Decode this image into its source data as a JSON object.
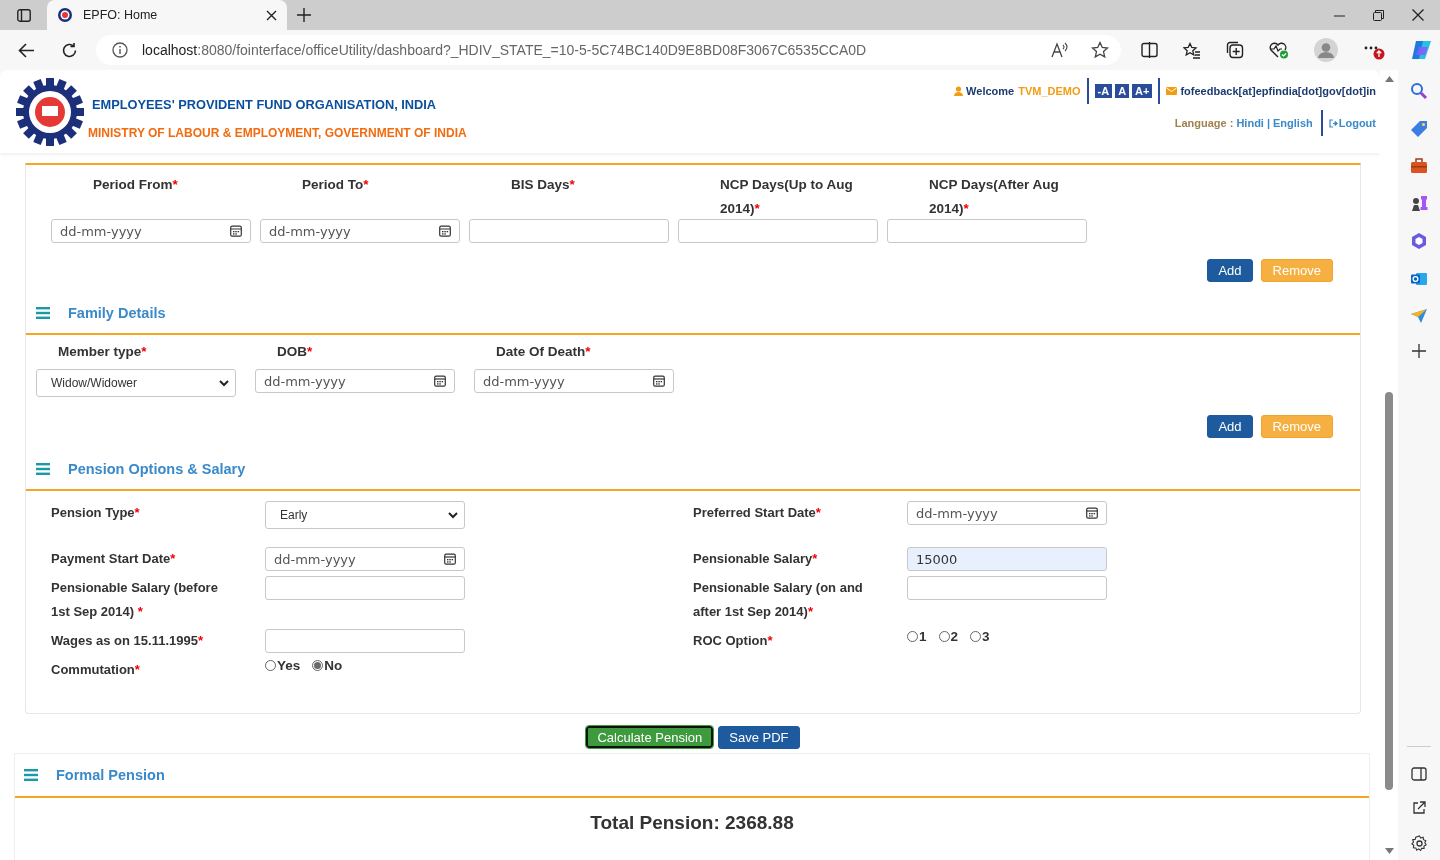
{
  "browser": {
    "tab_title": "EPFO: Home",
    "url_host": "localhost",
    "url_path": ":8080/fointerface/officeUtility/dashboard?_HDIV_STATE_=10-5-5C74BC140D9E8BD08F3067C6535CCA0D"
  },
  "header": {
    "org_name": "EMPLOYEES' PROVIDENT FUND ORGANISATION, INDIA",
    "ministry": "MINISTRY OF LABOUR & EMPLOYMENT, GOVERNMENT OF INDIA",
    "welcome": "Welcome",
    "username": "TVM_DEMO",
    "font_sizes": [
      "-A",
      "A",
      "A+"
    ],
    "email": "fofeedback[at]epfindia[dot]gov[dot]in",
    "language_label": "Language :",
    "languages": [
      "Hindi",
      "English"
    ],
    "language_separator": "|",
    "logout": "Logout"
  },
  "scheme_section": {
    "fields": [
      {
        "label": "Period From",
        "mark": "*",
        "kind": "date",
        "placeholder": "dd-mm-yyyy"
      },
      {
        "label": "Period To",
        "mark": "*",
        "kind": "date",
        "placeholder": "dd-mm-yyyy"
      },
      {
        "label": "BIS Days",
        "mark": "*",
        "kind": "text"
      },
      {
        "label": "NCP Days(Up to Aug 2014)",
        "mark": "*",
        "kind": "text"
      },
      {
        "label": "NCP Days(After Aug 2014)",
        "mark": "*",
        "kind": "text"
      }
    ],
    "actions": [
      "Add",
      "Remove"
    ]
  },
  "family_section": {
    "title": "Family Details",
    "fields": [
      {
        "label": "Member type",
        "mark": "*",
        "kind": "select",
        "value": "Widow/Widower"
      },
      {
        "label": "DOB",
        "mark": "*",
        "kind": "date",
        "placeholder": "dd-mm-yyyy"
      },
      {
        "label": "Date Of Death",
        "mark": "*",
        "kind": "date",
        "placeholder": "dd-mm-yyyy"
      }
    ],
    "actions": [
      "Add",
      "Remove"
    ]
  },
  "pension_section": {
    "title": "Pension Options & Salary",
    "rows": [
      [
        {
          "label": "Pension Type",
          "mark": "*",
          "kind": "select",
          "value": "Early"
        },
        {
          "label": "Preferred Start Date",
          "mark": "*",
          "kind": "date",
          "placeholder": "dd-mm-yyyy"
        }
      ],
      [
        {
          "label": "Payment Start Date",
          "mark": "*",
          "kind": "date",
          "placeholder": "dd-mm-yyyy"
        },
        {
          "label": "Pensionable Salary",
          "mark": "*",
          "kind": "text",
          "value": "15000",
          "highlighted": true
        }
      ],
      [
        {
          "label": "Pensionable Salary (before 1st Sep 2014) ",
          "mark": "*",
          "kind": "text"
        },
        {
          "label": "Pensionable Salary (on and after 1st Sep 2014)",
          "mark": "*",
          "kind": "text"
        }
      ],
      [
        {
          "label": "Wages as on 15.11.1995",
          "mark": "*",
          "kind": "text"
        },
        {
          "label": "ROC Option",
          "mark": "*",
          "kind": "radio",
          "options": [
            {
              "label": "1",
              "selected": false
            },
            {
              "label": "2",
              "selected": false
            },
            {
              "label": "3",
              "selected": false
            }
          ]
        }
      ],
      [
        {
          "label": "Commutation",
          "mark": "*",
          "kind": "radio",
          "options": [
            {
              "label": "Yes",
              "selected": false
            },
            {
              "label": "No",
              "selected": true
            }
          ]
        }
      ]
    ]
  },
  "actions": [
    {
      "label": "Calculate Pension",
      "kind": "primary"
    },
    {
      "label": "Save PDF",
      "kind": "secondary"
    }
  ],
  "formal_pension": {
    "title": "Formal Pension",
    "total": "Total Pension: 2368.88"
  }
}
